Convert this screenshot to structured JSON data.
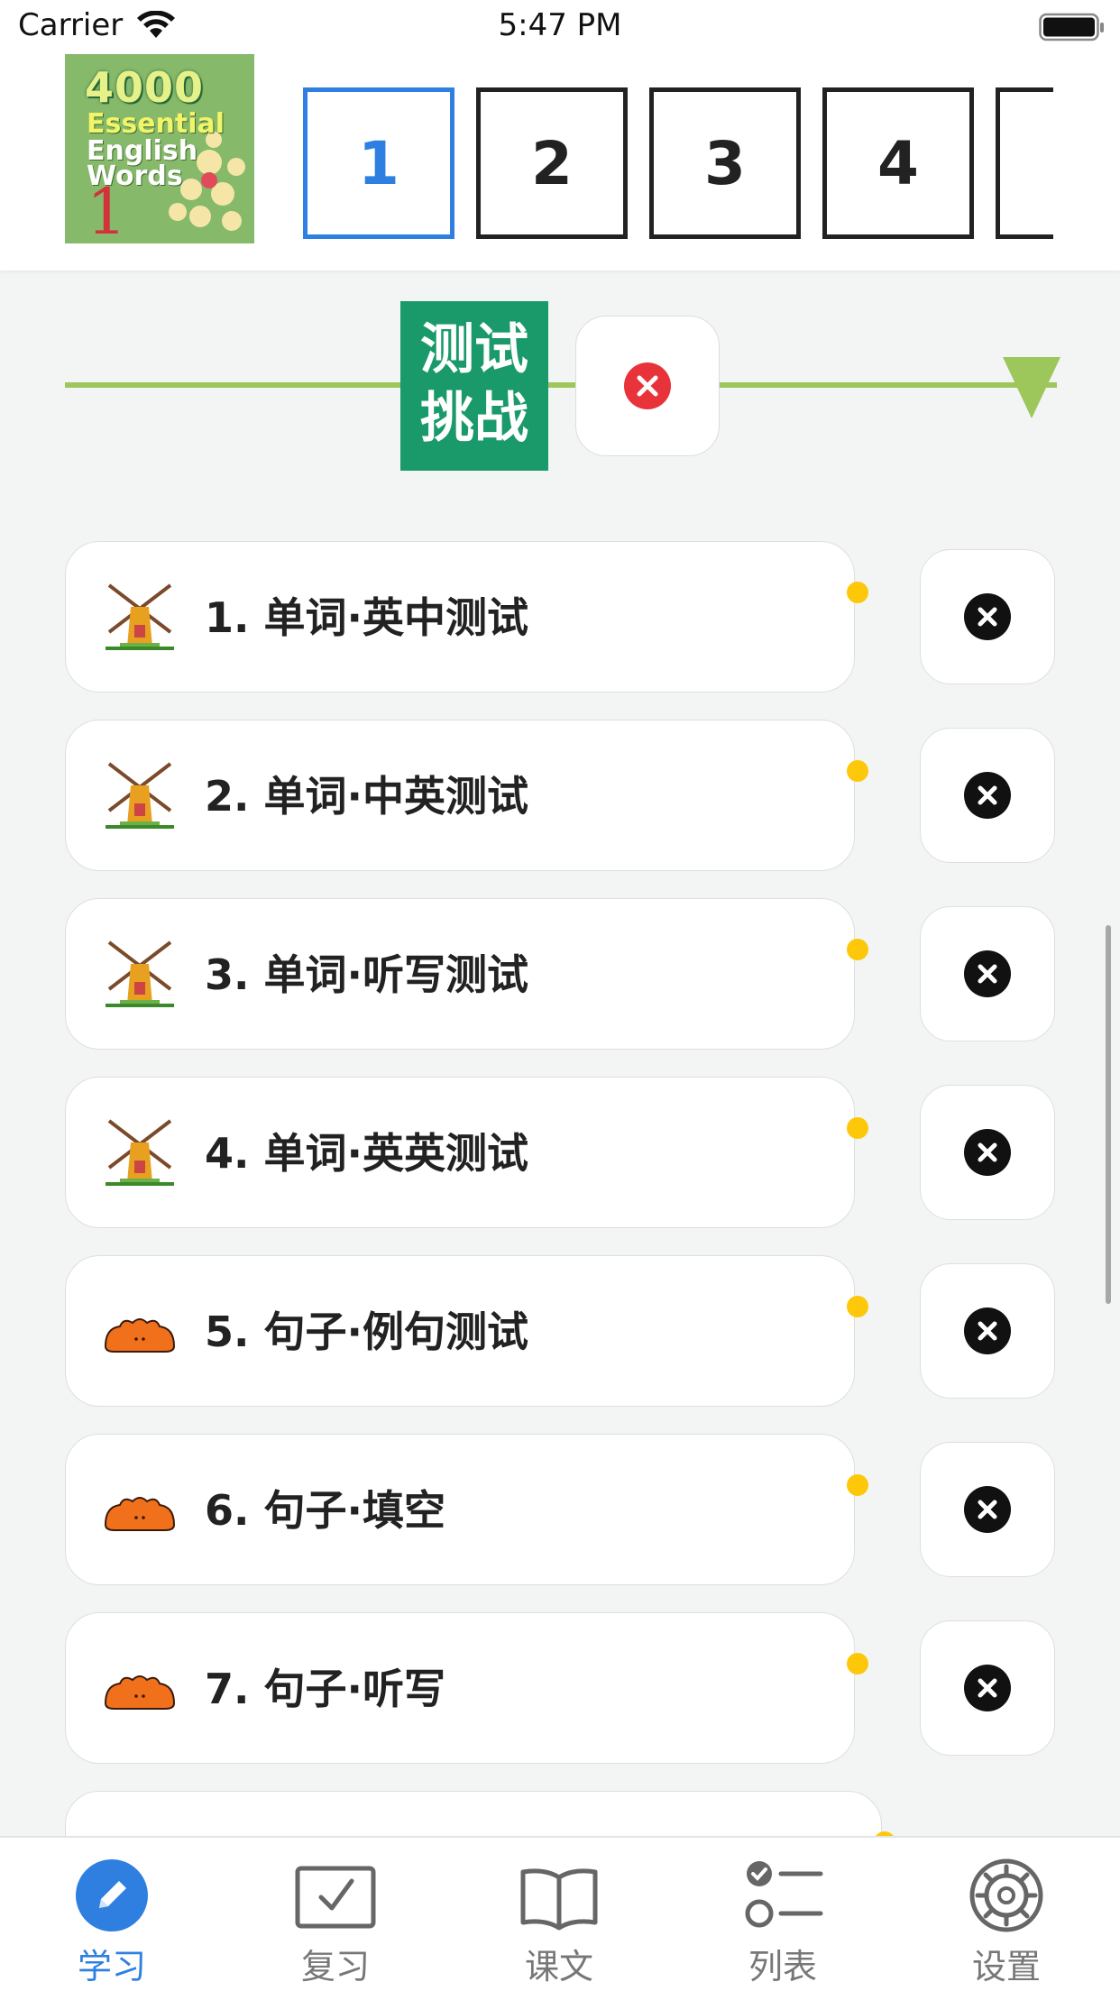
{
  "status_bar": {
    "carrier": "Carrier",
    "time": "5:47 PM"
  },
  "book": {
    "cover_line1": "4000",
    "cover_line2": "Essential",
    "cover_line3": "English",
    "cover_line4": "Words",
    "cover_volume": "1"
  },
  "units": [
    {
      "label": "1",
      "selected": true
    },
    {
      "label": "2",
      "selected": false
    },
    {
      "label": "3",
      "selected": false
    },
    {
      "label": "4",
      "selected": false
    }
  ],
  "challenge": {
    "line1": "测试",
    "line2": "挑战"
  },
  "exercises": [
    {
      "label": "1. 单词·英中测试",
      "icon": "windmill-icon"
    },
    {
      "label": "2. 单词·中英测试",
      "icon": "windmill-icon"
    },
    {
      "label": "3. 单词·听写测试",
      "icon": "windmill-icon"
    },
    {
      "label": "4. 单词·英英测试",
      "icon": "windmill-icon"
    },
    {
      "label": "5. 句子·例句测试",
      "icon": "orange-creature-icon"
    },
    {
      "label": "6. 句子·填空",
      "icon": "orange-creature-icon"
    },
    {
      "label": "7. 句子·听写",
      "icon": "orange-creature-icon"
    }
  ],
  "tabs": [
    {
      "label": "学习",
      "icon": "pencil-icon",
      "active": true
    },
    {
      "label": "复习",
      "icon": "checkbox-icon",
      "active": false
    },
    {
      "label": "课文",
      "icon": "book-icon",
      "active": false
    },
    {
      "label": "列表",
      "icon": "checklist-icon",
      "active": false
    },
    {
      "label": "设置",
      "icon": "gear-icon",
      "active": false
    }
  ],
  "colors": {
    "accent_blue": "#2f7fe0",
    "challenge_green": "#1a9a6a",
    "track_green": "#9dc65b",
    "status_dot_yellow": "#fdc70a",
    "close_red": "#e8333a"
  }
}
